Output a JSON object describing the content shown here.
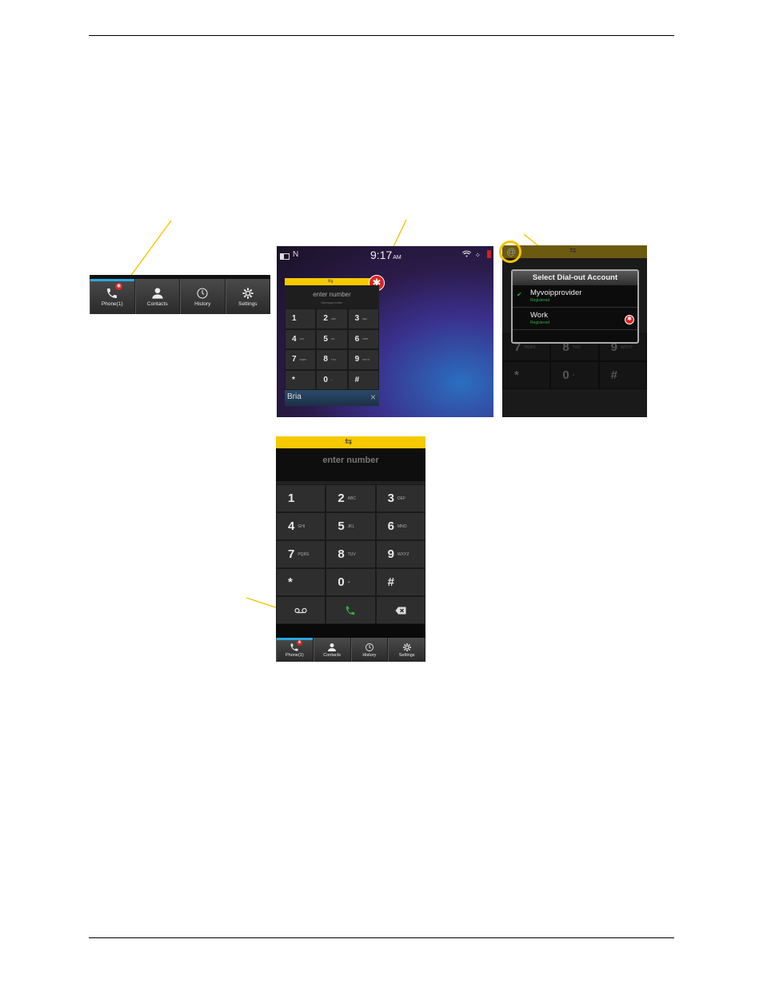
{
  "fig_a": {
    "tabs": [
      {
        "label": "Phone(1)",
        "icon": "phone-icon",
        "badge": "✳"
      },
      {
        "label": "Contacts",
        "icon": "contacts-icon"
      },
      {
        "label": "History",
        "icon": "clock-icon"
      },
      {
        "label": "Settings",
        "icon": "gear-icon"
      }
    ]
  },
  "fig_b": {
    "time": "9:17",
    "ampm": "AM",
    "network": "N",
    "placeholder": "enter number",
    "account": "Myvoipprovider",
    "keys": [
      {
        "digit": "1",
        "letters": ""
      },
      {
        "digit": "2",
        "letters": "ABC"
      },
      {
        "digit": "3",
        "letters": "DEF"
      },
      {
        "digit": "4",
        "letters": "GHI"
      },
      {
        "digit": "5",
        "letters": "JKL"
      },
      {
        "digit": "6",
        "letters": "MNO"
      },
      {
        "digit": "7",
        "letters": "PQRS"
      },
      {
        "digit": "8",
        "letters": "TUV"
      },
      {
        "digit": "9",
        "letters": "WXYZ"
      },
      {
        "digit": "*",
        "letters": ""
      },
      {
        "digit": "0",
        "letters": "+"
      },
      {
        "digit": "#",
        "letters": ""
      }
    ],
    "app_label": "Bria",
    "close": "×"
  },
  "fig_c": {
    "at": "@",
    "dialog_title": "Select Dial-out Account",
    "accounts": [
      {
        "name": "Myvoipprovider",
        "status": "Registered",
        "checked": true
      },
      {
        "name": "Work",
        "status": "Registered",
        "checked": false
      }
    ],
    "bg_keys": [
      {
        "digit": "7",
        "letters": "PQRS"
      },
      {
        "digit": "8",
        "letters": "TUV"
      },
      {
        "digit": "9",
        "letters": "WXYZ"
      },
      {
        "digit": "*",
        "letters": ""
      },
      {
        "digit": "0",
        "letters": "+"
      },
      {
        "digit": "#",
        "letters": ""
      }
    ]
  },
  "fig_d": {
    "placeholder": "enter number",
    "keys": [
      {
        "digit": "1",
        "letters": ""
      },
      {
        "digit": "2",
        "letters": "ABC"
      },
      {
        "digit": "3",
        "letters": "DEF"
      },
      {
        "digit": "4",
        "letters": "GHI"
      },
      {
        "digit": "5",
        "letters": "JKL"
      },
      {
        "digit": "6",
        "letters": "MNO"
      },
      {
        "digit": "7",
        "letters": "PQRS"
      },
      {
        "digit": "8",
        "letters": "TUV"
      },
      {
        "digit": "9",
        "letters": "WXYZ"
      },
      {
        "digit": "*",
        "letters": ""
      },
      {
        "digit": "0",
        "letters": "+"
      },
      {
        "digit": "#",
        "letters": ""
      }
    ],
    "tabs": [
      {
        "label": "Phone(1)",
        "icon": "phone-icon",
        "badge": "✳"
      },
      {
        "label": "Contacts",
        "icon": "contacts-icon"
      },
      {
        "label": "History",
        "icon": "clock-icon"
      },
      {
        "label": "Settings",
        "icon": "gear-icon"
      }
    ]
  },
  "colors": {
    "callout": "#f5c400",
    "accent_blue": "#29a8e0",
    "banner_yellow": "#f7c900",
    "badge_red": "#d22222",
    "call_green": "#2fae3c"
  }
}
